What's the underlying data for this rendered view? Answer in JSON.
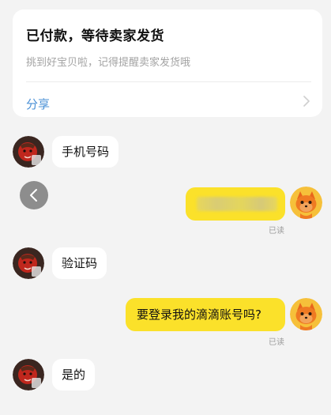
{
  "order_card": {
    "title": "已付款，等待卖家发货",
    "subtitle": "挑到好宝贝啦，记得提醒卖家发货哦",
    "share_label": "分享"
  },
  "messages": [
    {
      "side": "left",
      "text": "手机号码"
    },
    {
      "side": "right",
      "text": "",
      "redacted": true,
      "status": "已读"
    },
    {
      "side": "left",
      "text": "验证码"
    },
    {
      "side": "right",
      "text": "要登录我的滴滴账号吗?",
      "status": "已读"
    },
    {
      "side": "left",
      "text": "是的"
    }
  ],
  "colors": {
    "background": "#f3f3f3",
    "own_bubble": "#fbe12a",
    "share_link": "#4a90d6"
  },
  "icons": {
    "share_chevron": "chevron-right-icon",
    "back_button": "chevron-left-icon",
    "left_avatar": "red-character-avatar",
    "right_avatar": "orange-fox-avatar"
  }
}
